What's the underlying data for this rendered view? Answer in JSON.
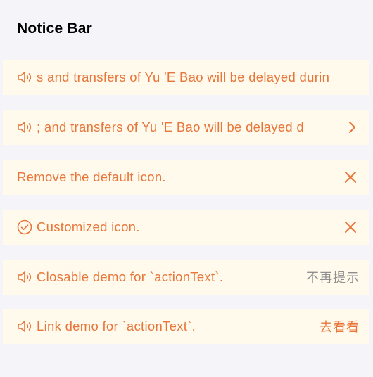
{
  "page": {
    "title": "Notice Bar"
  },
  "colors": {
    "background": "#f5f5f9",
    "bar_background": "#fffaeb",
    "accent": "#e8753a",
    "muted": "#8f8f8f"
  },
  "notices": [
    {
      "icon": "speaker-icon",
      "text": "The recharges and transfers of Yu 'E Bao will be delayed during the Spring Festival.",
      "visible_text": "s and transfers of Yu 'E Bao will be delayed durin",
      "action": null
    },
    {
      "icon": "speaker-icon",
      "text": "The recharges and transfers of Yu 'E Bao will be delayed during the Spring Festival.",
      "visible_text": "; and transfers of Yu 'E Bao will be delayed d",
      "action": "chevron-right-icon"
    },
    {
      "icon": null,
      "text": "Remove the default icon.",
      "action": "close-icon"
    },
    {
      "icon": "check-circle-icon",
      "text": "Customized icon.",
      "action": "close-icon"
    },
    {
      "icon": "speaker-icon",
      "text": "Closable demo for `actionText`.",
      "action_text": "不再提示"
    },
    {
      "icon": "speaker-icon",
      "text": "Link demo for `actionText`.",
      "action_text": "去看看"
    }
  ]
}
